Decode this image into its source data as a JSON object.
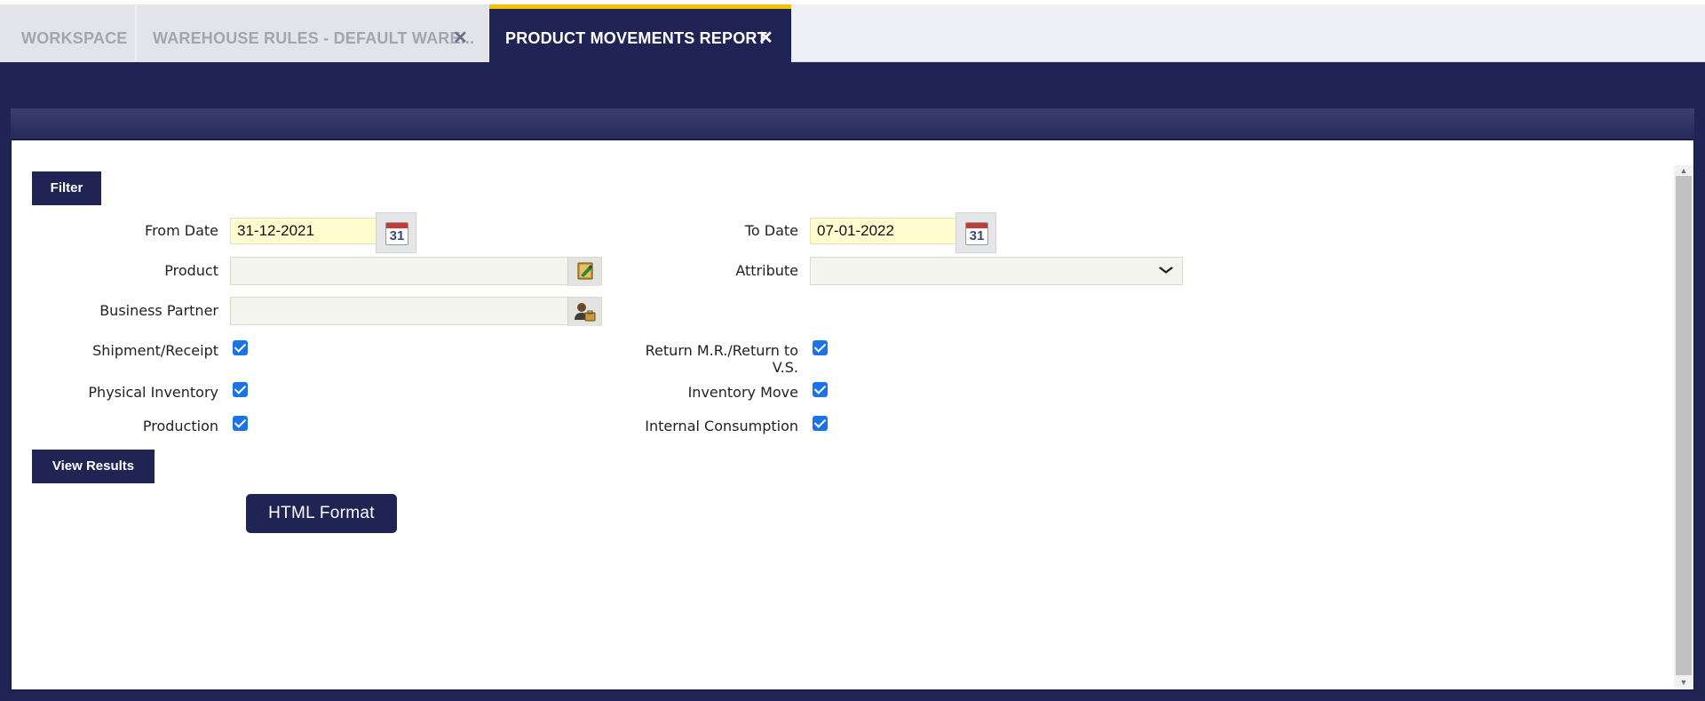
{
  "tabs": [
    {
      "label": "WORKSPACE",
      "closable": false
    },
    {
      "label": "WAREHOUSE RULES - DEFAULT WARE...",
      "closable": true,
      "close_icon": "✕"
    },
    {
      "label": "PRODUCT MOVEMENTS REPORT",
      "closable": true,
      "active": true,
      "close_icon": "✕"
    }
  ],
  "form": {
    "filter_label": "Filter",
    "from_date": {
      "label": "From Date",
      "value": "31-12-2021",
      "calendar_day": "31"
    },
    "to_date": {
      "label": "To Date",
      "value": "07-01-2022",
      "calendar_day": "31"
    },
    "product": {
      "label": "Product",
      "value": ""
    },
    "attribute": {
      "label": "Attribute",
      "value": ""
    },
    "business_partner": {
      "label": "Business Partner",
      "value": ""
    },
    "shipment_receipt": {
      "label": "Shipment/Receipt",
      "checked": true
    },
    "return_mr": {
      "label_line1": "Return M.R./Return to",
      "label_line2": "V.S.",
      "checked": true
    },
    "physical_inventory": {
      "label": "Physical Inventory",
      "checked": true
    },
    "inventory_move": {
      "label": "Inventory Move",
      "checked": true
    },
    "production": {
      "label": "Production",
      "checked": true
    },
    "internal_consumption": {
      "label": "Internal Consumption",
      "checked": true
    },
    "view_results_label": "View Results",
    "html_format_label": "HTML Format"
  },
  "icons": {
    "calendar": "calendar-icon",
    "product_selector": "product-search-icon",
    "partner_selector": "business-partner-icon",
    "dropdown": "chevron-down-icon"
  },
  "colors": {
    "primary": "#202455",
    "active_tab_accent": "#f3c300",
    "date_field_bg": "#fffcd0",
    "checkbox": "#1a73e8"
  }
}
